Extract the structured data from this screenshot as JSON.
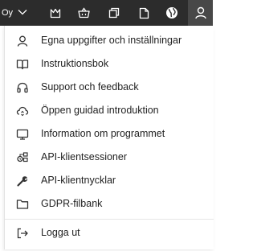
{
  "topbar": {
    "org_label": "Oy",
    "icons": [
      "chevron-down-icon",
      "crown-icon",
      "basket-icon",
      "copy-icon",
      "document-icon",
      "globe-icon",
      "user-icon"
    ]
  },
  "menu": {
    "items": [
      {
        "label": "Egna uppgifter och inställningar",
        "icon": "user-icon"
      },
      {
        "label": "Instruktionsbok",
        "icon": "book-icon"
      },
      {
        "label": "Support och feedback",
        "icon": "headset-icon"
      },
      {
        "label": "Öppen guidad introduktion",
        "icon": "cloud-sync-icon"
      },
      {
        "label": "Information om programmet",
        "icon": "monitor-icon"
      },
      {
        "label": "API-klientsessioner",
        "icon": "api-sessions-icon"
      },
      {
        "label": "API-klientnycklar",
        "icon": "wrench-icon"
      },
      {
        "label": "GDPR-filbank",
        "icon": "folder-icon"
      }
    ],
    "logout": {
      "label": "Logga ut",
      "icon": "logout-icon"
    }
  }
}
